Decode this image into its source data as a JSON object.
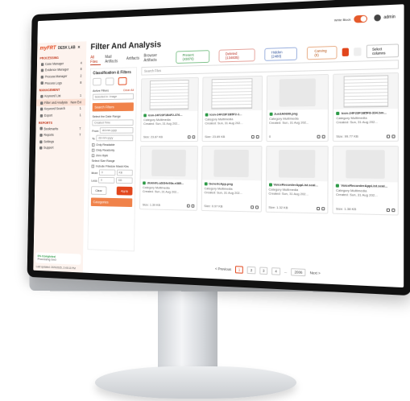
{
  "topbar": {
    "toggle_label": "Write Block",
    "user": "admin"
  },
  "sidebar": {
    "brand_logo": "myFRT",
    "brand_app": "DESK LAB",
    "sections": [
      {
        "title": "PROCESSING",
        "items": [
          {
            "label": "Case Manager",
            "count": "4"
          },
          {
            "label": "Evidence Manager",
            "count": "8"
          },
          {
            "label": "Process Manager",
            "count": "2"
          },
          {
            "label": "Process Logs",
            "count": "8"
          }
        ]
      },
      {
        "title": "MANAGEMENT",
        "items": [
          {
            "label": "Keyword List",
            "count": "1"
          },
          {
            "label": "Filter and Analysis",
            "count": "New Ext"
          },
          {
            "label": "Keyword Search",
            "count": "1"
          },
          {
            "label": "Export",
            "count": "1"
          }
        ]
      },
      {
        "title": "REPORTS",
        "items": [
          {
            "label": "Bookmarks",
            "count": "7"
          },
          {
            "label": "Reports",
            "count": "7"
          }
        ]
      },
      {
        "title": "",
        "items": [
          {
            "label": "Settings",
            "count": ""
          },
          {
            "label": "Support",
            "count": ""
          }
        ]
      }
    ],
    "footer_status": "0% Completed",
    "footer_sub": "Processing 0m0",
    "last_updated": "Last updated: 30/9/2025, 2:45:13 PM"
  },
  "main": {
    "title": "Filter And Analysis",
    "tabs": [
      "All Files",
      "Mail Artifacts",
      "Artifacts",
      "Browser Artifacts"
    ],
    "pills": [
      {
        "label": "Present (43870)",
        "tone": "g"
      },
      {
        "label": "Deleted (134835)",
        "tone": "r"
      },
      {
        "label": "Hidden (2480)",
        "tone": "b"
      },
      {
        "label": "Carving (0)",
        "tone": "o"
      }
    ],
    "select_columns": "Select columns"
  },
  "filters": {
    "title": "Classification & Filters",
    "active": "Active Filters",
    "clear": "Clear All",
    "chip": "Selected in: Image",
    "panel": "Search Filters",
    "date_range": "Select the Date Range",
    "created": "Created Time",
    "from": "From",
    "to": "To",
    "date_placeholder": "dd-mm-yyyy",
    "only_readable": "Only Readable",
    "only_readonly": "Only Readonly",
    "zero": "Zero Byte",
    "size_range": "Select Size Range",
    "include_size": "Include Filesize Mask Kbs",
    "more": "More",
    "less": "Less",
    "unit": "KB",
    "clear_btn": "Clear",
    "apply_btn": "Apply",
    "categories": "Categories"
  },
  "grid": {
    "search_placeholder": "Search Files",
    "cards": [
      {
        "name": "icon-24F23F1B4F2-376...",
        "cat": "Category Multimedia",
        "created": "Created: Sun, 31 Aug 202...",
        "size": "Size: 23.87 KB",
        "thumb": "doc"
      },
      {
        "name": "icon-24F23F1B5F2-1...",
        "cat": "Category Multimedia",
        "created": "Created: Sun, 31 Aug 202...",
        "size": "Size: 23.69 KB",
        "thumb": "doc"
      },
      {
        "name": "Jun3A0699.png",
        "cat": "Category Multimedia",
        "created": "Created: Sun, 31 Aug 202...",
        "size": "0",
        "thumb": "img"
      },
      {
        "name": "icon-24F23F1B5F8-334.bm...",
        "cat": "Category Multimedia",
        "created": "Created: Sun, 31 Aug 202...",
        "size": "Size: 99.77 KB",
        "thumb": "doc"
      },
      {
        "name": "diskinfo.aSt34e93a-e385...",
        "cat": "Category Multimedia",
        "created": "Created: Sun, 31 Aug 202...",
        "size": "Size: 1.39 KB",
        "thumb": "img"
      },
      {
        "name": "GenericApp.png",
        "cat": "Category Multimedia",
        "created": "Created: Sun, 31 Aug 202...",
        "size": "Size: 0.97 KB",
        "thumb": "img"
      },
      {
        "name": "VoiceRecorderAppList.scal...",
        "cat": "Category Multimedia",
        "created": "Created: Sun, 31 Aug 202...",
        "size": "Size: 1.32 KB",
        "thumb": "img"
      },
      {
        "name": "VoiceRecorderAppList.scal...",
        "cat": "Category Multimedia",
        "created": "Created: Sun, 31 Aug 202...",
        "size": "Size: 1.38 KB",
        "thumb": "img"
      }
    ]
  },
  "pager": {
    "prev": "< Previous",
    "pages": [
      "1",
      "2",
      "3",
      "4",
      "...",
      "2006"
    ],
    "next": "Next >"
  }
}
